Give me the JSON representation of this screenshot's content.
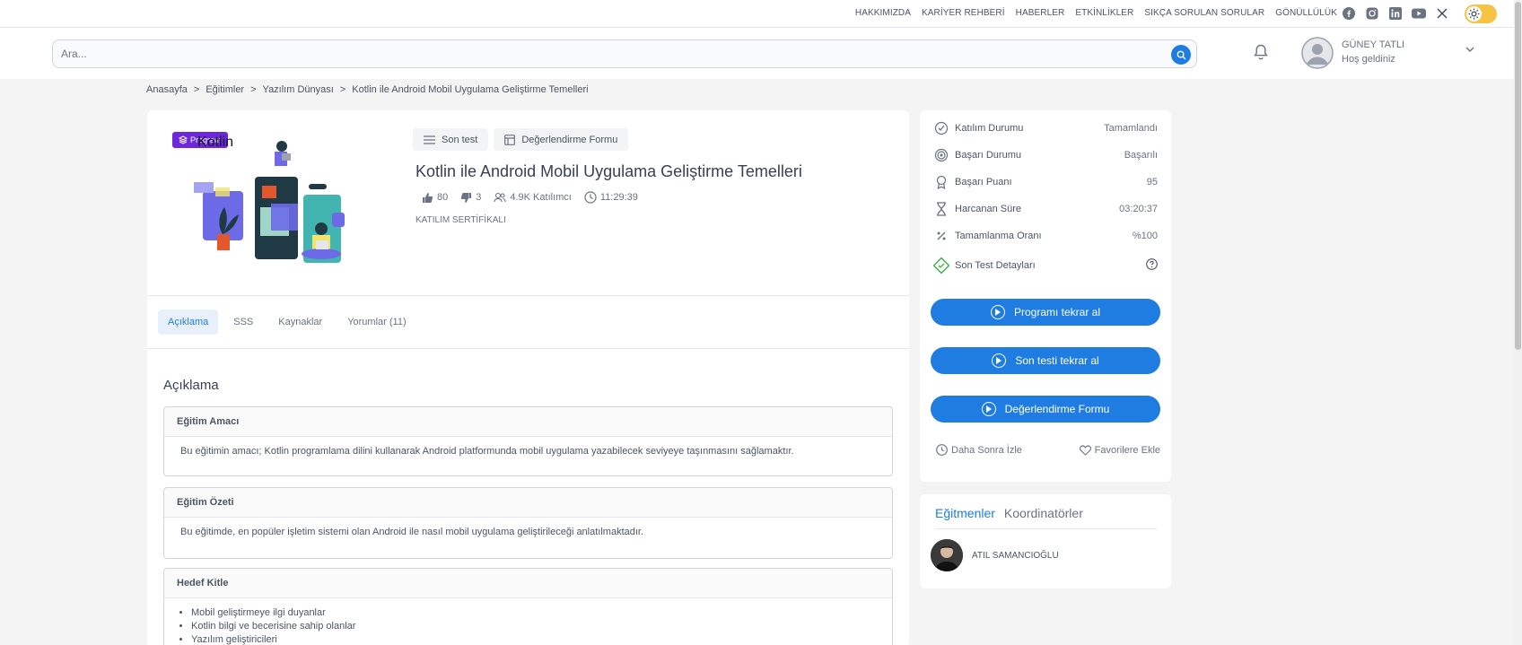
{
  "toplinks": [
    "HAKKIMIZDA",
    "KARİYER REHBERİ",
    "HABERLER",
    "ETKİNLİKLER",
    "SIKÇA SORULAN SORULAR",
    "GÖNÜLLÜLÜK"
  ],
  "social_icons": [
    "facebook-icon",
    "instagram-icon",
    "linkedin-icon",
    "youtube-icon",
    "x-icon"
  ],
  "search": {
    "placeholder": "Ara..."
  },
  "user": {
    "name": "GÜNEY TATLI",
    "greeting": "Hoş geldiniz"
  },
  "breadcrumb": [
    "Anasayfa",
    ">",
    "Eğitimler",
    ">",
    "Yazılım Dünyası",
    ">",
    "Kotlin ile Android Mobil Uygulama Geliştirme Temelleri"
  ],
  "course": {
    "badge": "Program",
    "image_text": "Kotlin",
    "buttons": {
      "last_test": "Son test",
      "eval_form": "Değerlendirme Formu"
    },
    "title": "Kotlin ile Android Mobil Uygulama Geliştirme Temelleri",
    "likes": "80",
    "dislikes": "3",
    "participants": "4.9K Katılımcı",
    "duration": "11:29:39",
    "certificate": "KATILIM SERTİFİKALI"
  },
  "tabs": [
    "Açıklama",
    "SSS",
    "Kaynaklar",
    "Yorumlar (11)"
  ],
  "description": {
    "title": "Açıklama",
    "sections": [
      {
        "head": "Eğitim Amacı",
        "body": "Bu eğitimin amacı; Kotlin programlama dilini kullanarak Android platformunda mobil uygulama yazabilecek seviyeye taşınmasını sağlamaktır."
      },
      {
        "head": "Eğitim Özeti",
        "body": "Bu eğitimde, en popüler işletim sistemi olan Android ile nasıl mobil uygulama geliştirileceği anlatılmaktadır."
      },
      {
        "head": "Hedef Kitle",
        "items": [
          "Mobil geliştirmeye ilgi duyanlar",
          "Kotlin bilgi ve becerisine sahip olanlar",
          "Yazılım geliştiricileri"
        ]
      }
    ]
  },
  "status": [
    {
      "label": "Katılım Durumu",
      "value": "Tamamlandı",
      "icon": "check-circle-icon"
    },
    {
      "label": "Başarı Durumu",
      "value": "Başarılı",
      "icon": "target-icon"
    },
    {
      "label": "Başarı Puanı",
      "value": "95",
      "icon": "award-icon"
    },
    {
      "label": "Harcanan Süre",
      "value": "03:20:37",
      "icon": "hourglass-icon"
    },
    {
      "label": "Tamamlanma Oranı",
      "value": "%100",
      "icon": "percent-icon"
    },
    {
      "label": "Son Test Detayları",
      "value": "",
      "icon": "test-detail-icon"
    }
  ],
  "actions": [
    "Programı tekrar al",
    "Son testi tekrar al",
    "Değerlendirme Formu"
  ],
  "side_links": {
    "watch_later": "Daha Sonra İzle",
    "favorites": "Favorilere Ekle"
  },
  "instructors": {
    "tab_active": "Eğitmenler",
    "tab_other": "Koordinatörler",
    "name": "ATIL SAMANCIOĞLU"
  },
  "colors": {
    "primary": "#1f7ce0",
    "badge": "#6d28d9",
    "toggle": "#f6c343"
  }
}
